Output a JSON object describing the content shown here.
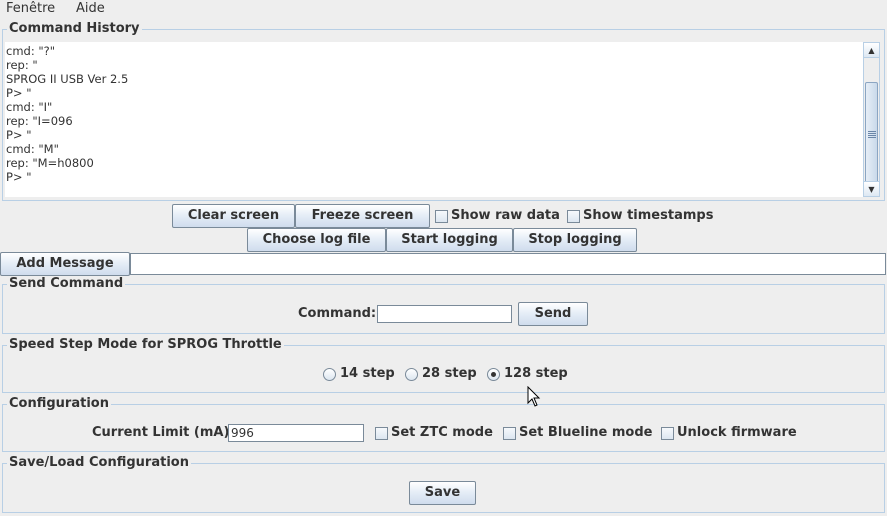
{
  "menu": {
    "window": "Fenêtre",
    "help": "Aide"
  },
  "history": {
    "title": "Command History",
    "lines": [
      "cmd: \"?\"",
      "rep: \"",
      "SPROG II USB Ver 2.5",
      "P> \"",
      "cmd: \"I\"",
      "rep: \"I=096",
      "P> \"",
      "cmd: \"M\"",
      "rep: \"M=h0800",
      "P> \""
    ]
  },
  "toolbar": {
    "clear_screen": "Clear screen",
    "freeze_screen": "Freeze screen",
    "show_raw_data": "Show raw data",
    "show_timestamps": "Show timestamps",
    "choose_log_file": "Choose log file",
    "start_logging": "Start logging",
    "stop_logging": "Stop logging",
    "add_message": "Add Message",
    "message_value": ""
  },
  "send_command": {
    "title": "Send Command",
    "label": "Command:",
    "value": "",
    "send": "Send"
  },
  "speed_step": {
    "title": "Speed Step Mode for SPROG Throttle",
    "options": [
      "14 step",
      "28 step",
      "128 step"
    ],
    "selected": "128 step"
  },
  "configuration": {
    "title": "Configuration",
    "current_limit_label": "Current Limit (mA):",
    "current_limit_value": "996",
    "set_ztc_mode": "Set ZTC mode",
    "set_blueline_mode": "Set Blueline mode",
    "unlock_firmware": "Unlock firmware"
  },
  "save_load": {
    "title": "Save/Load Configuration",
    "save": "Save"
  },
  "colors": {
    "background": "#eeeeee",
    "border": "#b8cfe5",
    "button_gradient_top": "#ffffff",
    "button_gradient_bottom": "#cfdced"
  }
}
